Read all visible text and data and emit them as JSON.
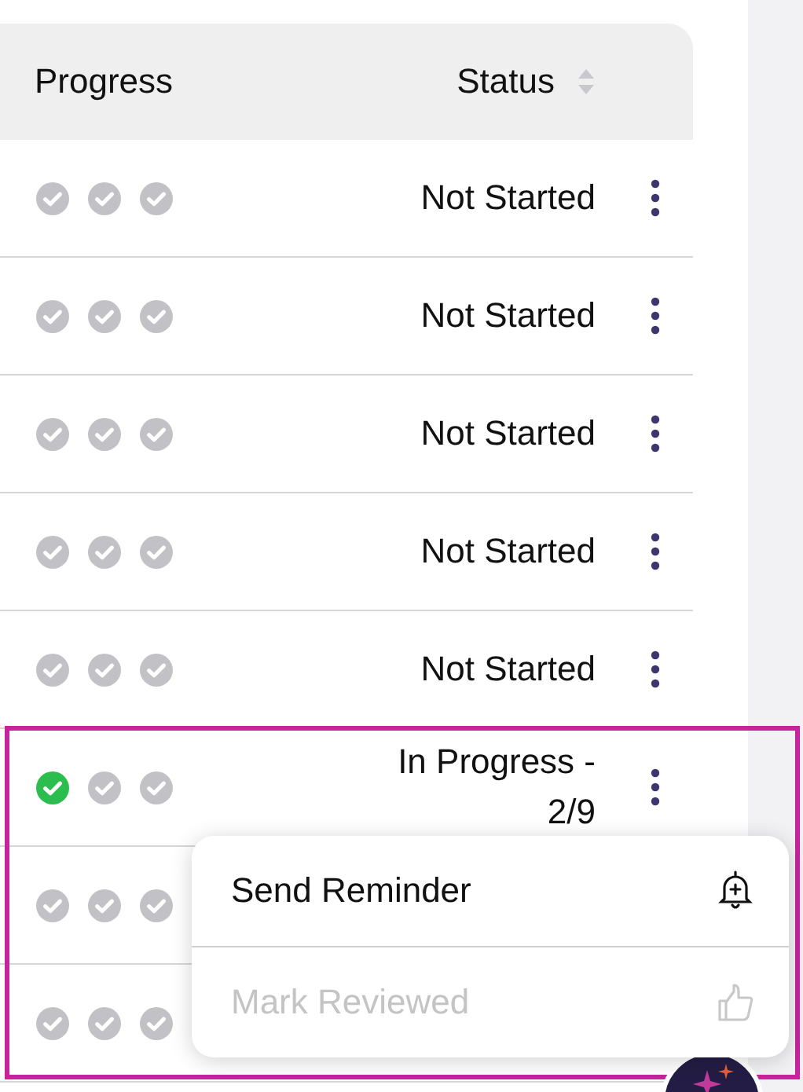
{
  "table": {
    "columns": [
      {
        "label": "Progress",
        "sortable": false
      },
      {
        "label": "Status",
        "sortable": true
      }
    ],
    "rows": [
      {
        "steps": [
          {
            "done": false
          },
          {
            "done": false
          },
          {
            "done": false
          }
        ],
        "status": "Not Started",
        "highlighted": false
      },
      {
        "steps": [
          {
            "done": false
          },
          {
            "done": false
          },
          {
            "done": false
          }
        ],
        "status": "Not Started",
        "highlighted": false
      },
      {
        "steps": [
          {
            "done": false
          },
          {
            "done": false
          },
          {
            "done": false
          }
        ],
        "status": "Not Started",
        "highlighted": false
      },
      {
        "steps": [
          {
            "done": false
          },
          {
            "done": false
          },
          {
            "done": false
          }
        ],
        "status": "Not Started",
        "highlighted": false
      },
      {
        "steps": [
          {
            "done": false
          },
          {
            "done": false
          },
          {
            "done": false
          }
        ],
        "status": "Not Started",
        "highlighted": false
      },
      {
        "steps": [
          {
            "done": true
          },
          {
            "done": false
          },
          {
            "done": false
          }
        ],
        "status": "In Progress - 2/9",
        "highlighted": true
      },
      {
        "steps": [
          {
            "done": false
          },
          {
            "done": false
          },
          {
            "done": false
          }
        ],
        "highlighted": true
      },
      {
        "steps": [
          {
            "done": false
          },
          {
            "done": false
          },
          {
            "done": false
          }
        ],
        "highlighted": true
      }
    ]
  },
  "menu": {
    "items": [
      {
        "label": "Send Reminder",
        "kind": "bell",
        "disabled": false
      },
      {
        "label": "Mark Reviewed",
        "kind": "thumb",
        "disabled": true
      }
    ]
  }
}
